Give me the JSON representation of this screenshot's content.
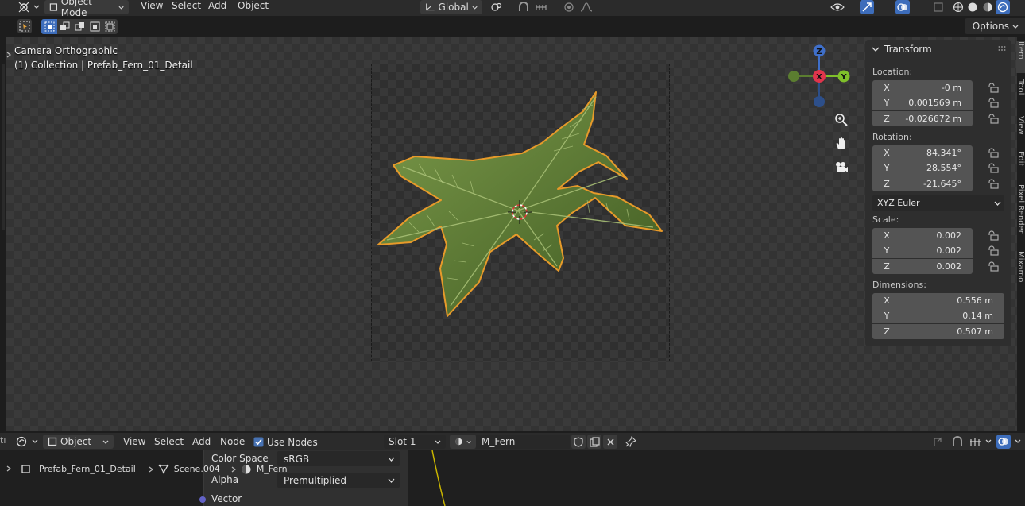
{
  "header": {
    "mode": "Object Mode",
    "menus": [
      "View",
      "Select",
      "Add",
      "Object"
    ],
    "orientation": "Global"
  },
  "options_label": "Options",
  "viewport": {
    "camera_label": "Camera Orthographic",
    "collection_label": "(1) Collection | Prefab_Fern_01_Detail"
  },
  "gizmo": {
    "x": "X",
    "y": "Y",
    "z": "Z"
  },
  "npanel": {
    "title": "Transform",
    "location_label": "Location:",
    "location": [
      {
        "axis": "X",
        "value": "-0 m"
      },
      {
        "axis": "Y",
        "value": "0.001569 m"
      },
      {
        "axis": "Z",
        "value": "-0.026672 m"
      }
    ],
    "rotation_label": "Rotation:",
    "rotation": [
      {
        "axis": "X",
        "value": "84.341°"
      },
      {
        "axis": "Y",
        "value": "28.554°"
      },
      {
        "axis": "Z",
        "value": "-21.645°"
      }
    ],
    "rotation_mode": "XYZ Euler",
    "scale_label": "Scale:",
    "scale": [
      {
        "axis": "X",
        "value": "0.002"
      },
      {
        "axis": "Y",
        "value": "0.002"
      },
      {
        "axis": "Z",
        "value": "0.002"
      }
    ],
    "dimensions_label": "Dimensions:",
    "dimensions": [
      {
        "axis": "X",
        "value": "0.556 m"
      },
      {
        "axis": "Y",
        "value": "0.14 m"
      },
      {
        "axis": "Z",
        "value": "0.507 m"
      }
    ],
    "tabs": [
      "Item",
      "Tool",
      "View",
      "Edit",
      "Pixel Render",
      "Mixamo"
    ]
  },
  "shader": {
    "type": "Object",
    "menus": [
      "View",
      "Select",
      "Add",
      "Node"
    ],
    "use_nodes_label": "Use Nodes",
    "slot": "Slot 1",
    "material": "M_Fern",
    "breadcrumb": {
      "object": "Prefab_Fern_01_Detail",
      "mesh": "Scene.004",
      "material": "M_Fern"
    },
    "node": {
      "color_space_label": "Color Space",
      "color_space_value": "sRGB",
      "alpha_label": "Alpha",
      "alpha_value": "Premultiplied",
      "vector_label": "Vector"
    }
  }
}
